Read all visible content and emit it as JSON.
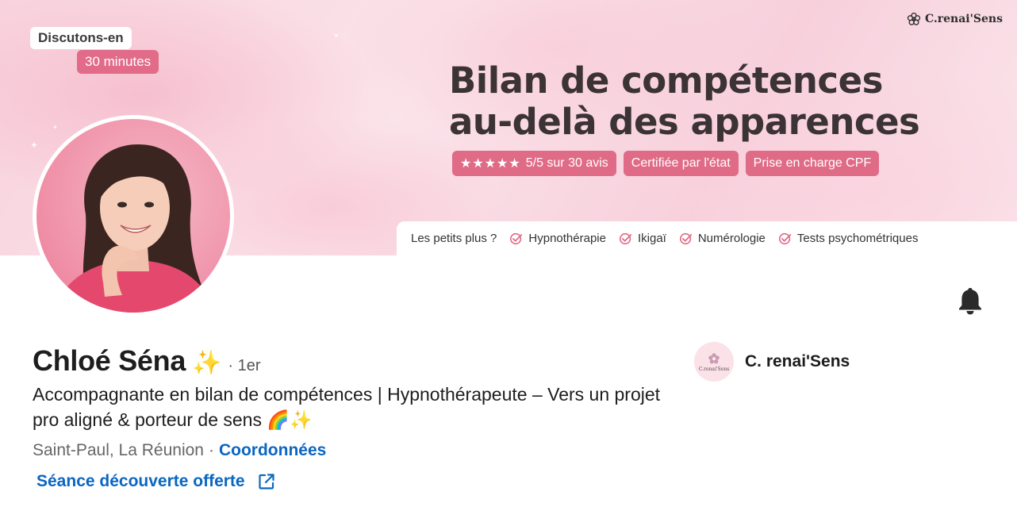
{
  "banner": {
    "brand": "C.renai'Sens",
    "tag_top": "Discutons-en",
    "tag_bottom": "30 minutes",
    "headline_line1": "Bilan de compétences",
    "headline_line2": "au-delà des apparences",
    "rating_stars": "★★★★★",
    "rating_text": "5/5 sur 30 avis",
    "pill_certified": "Certifiée par l'état",
    "pill_cpf": "Prise en charge CPF",
    "extras_label": "Les petits plus ?",
    "extras": [
      "Hypnothérapie",
      "Ikigaï",
      "Numérologie",
      "Tests psychométriques"
    ]
  },
  "profile": {
    "name": "Chloé Séna",
    "name_emoji": "✨",
    "degree": "· 1er",
    "headline": "Accompagnante en bilan de compétences | Hypnothérapeute – Vers un projet pro aligné & porteur de sens 🌈✨",
    "location": "Saint-Paul, La Réunion",
    "separator": "·",
    "contact_label": "Coordonnées",
    "website_label": "Séance découverte offerte"
  },
  "company": {
    "name": "C. renai'Sens",
    "logo_text": "C.renai'Sens"
  },
  "colors": {
    "accent_pink": "#e06b87",
    "link_blue": "#0a66c2",
    "text_dark": "#1d1d1d"
  },
  "icons": {
    "bell": "bell-icon",
    "external_link": "external-link-icon",
    "check": "check-circle-icon",
    "star": "star-icon",
    "flower": "flower-icon"
  }
}
